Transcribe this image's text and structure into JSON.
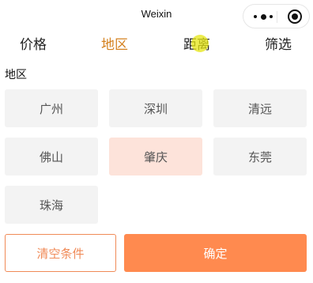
{
  "titlebar": {
    "title": "Weixin"
  },
  "capsule": {
    "menu_icon": "more-dots-icon",
    "close_icon": "target-close-icon"
  },
  "tabs": [
    {
      "label": "价格",
      "active": false
    },
    {
      "label": "地区",
      "active": true
    },
    {
      "label": "距离",
      "active": false
    },
    {
      "label": "筛选",
      "active": false
    }
  ],
  "section": {
    "label": "地区"
  },
  "regions": [
    {
      "label": "广州",
      "selected": false
    },
    {
      "label": "深圳",
      "selected": false
    },
    {
      "label": "清远",
      "selected": false
    },
    {
      "label": "佛山",
      "selected": false
    },
    {
      "label": "肇庆",
      "selected": true
    },
    {
      "label": "东莞",
      "selected": false
    },
    {
      "label": "珠海",
      "selected": false
    }
  ],
  "actions": {
    "clear_label": "清空条件",
    "confirm_label": "确定"
  },
  "colors": {
    "accent": "#ff8a4f",
    "active_tab": "#d4811f",
    "selected_bg": "#fde3da",
    "option_bg": "#f3f3f3"
  }
}
